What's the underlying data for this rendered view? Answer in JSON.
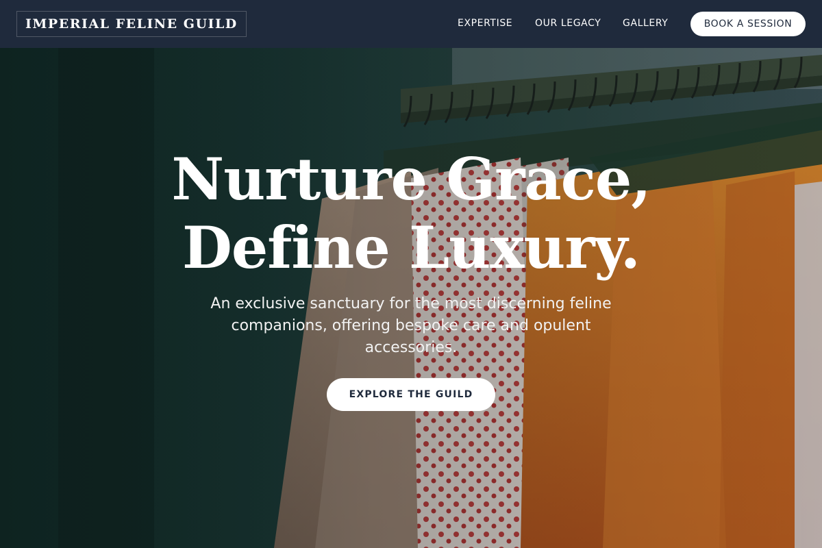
{
  "brand": {
    "name": "IMPERIAL FELINE GUILD"
  },
  "nav": {
    "links": [
      "EXPERTISE",
      "OUR LEGACY",
      "GALLERY"
    ],
    "cta_label": "BOOK A SESSION"
  },
  "hero": {
    "headline_line1": "Nurture Grace,",
    "headline_line2": "Define Luxury.",
    "subtitle": "An exclusive sanctuary for the most discerning feline companions, offering bespoke care and opulent accessories.",
    "cta_label": "EXPLORE THE GUILD",
    "image": "clothing-rack-photo"
  },
  "colors": {
    "nav_bg": "#1f2a3c",
    "button_bg": "#ffffff",
    "button_text": "#1f2a3c",
    "hero_text": "#ffffff"
  }
}
